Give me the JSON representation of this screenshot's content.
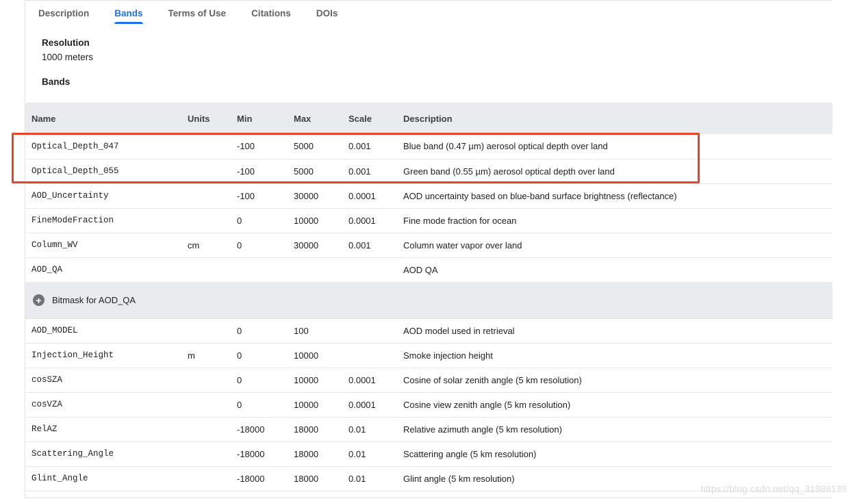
{
  "tabs": [
    {
      "label": "Description",
      "active": false
    },
    {
      "label": "Bands",
      "active": true
    },
    {
      "label": "Terms of Use",
      "active": false
    },
    {
      "label": "Citations",
      "active": false
    },
    {
      "label": "DOIs",
      "active": false
    }
  ],
  "info": {
    "resolution_heading": "Resolution",
    "resolution_value": "1000 meters",
    "bands_heading": "Bands"
  },
  "table": {
    "headers": [
      "Name",
      "Units",
      "Min",
      "Max",
      "Scale",
      "Description"
    ],
    "rows": [
      {
        "type": "band",
        "name": "Optical_Depth_047",
        "units": "",
        "min": "-100",
        "max": "5000",
        "scale": "0.001",
        "description": "Blue band (0.47 µm) aerosol optical depth over land"
      },
      {
        "type": "band",
        "name": "Optical_Depth_055",
        "units": "",
        "min": "-100",
        "max": "5000",
        "scale": "0.001",
        "description": "Green band (0.55 µm) aerosol optical depth over land"
      },
      {
        "type": "band",
        "name": "AOD_Uncertainty",
        "units": "",
        "min": "-100",
        "max": "30000",
        "scale": "0.0001",
        "description": "AOD uncertainty based on blue-band surface brightness (reflectance)"
      },
      {
        "type": "band",
        "name": "FineModeFraction",
        "units": "",
        "min": "0",
        "max": "10000",
        "scale": "0.0001",
        "description": "Fine mode fraction for ocean"
      },
      {
        "type": "band",
        "name": "Column_WV",
        "units": "cm",
        "min": "0",
        "max": "30000",
        "scale": "0.001",
        "description": "Column water vapor over land"
      },
      {
        "type": "band",
        "name": "AOD_QA",
        "units": "",
        "min": "",
        "max": "",
        "scale": "",
        "description": "AOD QA"
      },
      {
        "type": "bitmask",
        "label": "Bitmask for AOD_QA",
        "icon": "plus-circle-icon"
      },
      {
        "type": "band",
        "name": "AOD_MODEL",
        "units": "",
        "min": "0",
        "max": "100",
        "scale": "",
        "description": "AOD model used in retrieval"
      },
      {
        "type": "band",
        "name": "Injection_Height",
        "units": "m",
        "min": "0",
        "max": "10000",
        "scale": "",
        "description": "Smoke injection height"
      },
      {
        "type": "band",
        "name": "cosSZA",
        "units": "",
        "min": "0",
        "max": "10000",
        "scale": "0.0001",
        "description": "Cosine of solar zenith angle (5 km resolution)"
      },
      {
        "type": "band",
        "name": "cosVZA",
        "units": "",
        "min": "0",
        "max": "10000",
        "scale": "0.0001",
        "description": "Cosine view zenith angle (5 km resolution)"
      },
      {
        "type": "band",
        "name": "RelAZ",
        "units": "",
        "min": "-18000",
        "max": "18000",
        "scale": "0.01",
        "description": "Relative azimuth angle (5 km resolution)"
      },
      {
        "type": "band",
        "name": "Scattering_Angle",
        "units": "",
        "min": "-18000",
        "max": "18000",
        "scale": "0.01",
        "description": "Scattering angle (5 km resolution)"
      },
      {
        "type": "band",
        "name": "Glint_Angle",
        "units": "",
        "min": "-18000",
        "max": "18000",
        "scale": "0.01",
        "description": "Glint angle (5 km resolution)"
      }
    ]
  },
  "annotation": {
    "color": "#e8432d"
  },
  "watermark": {
    "text": "https://blog.csdn.net/qq_31988139"
  }
}
